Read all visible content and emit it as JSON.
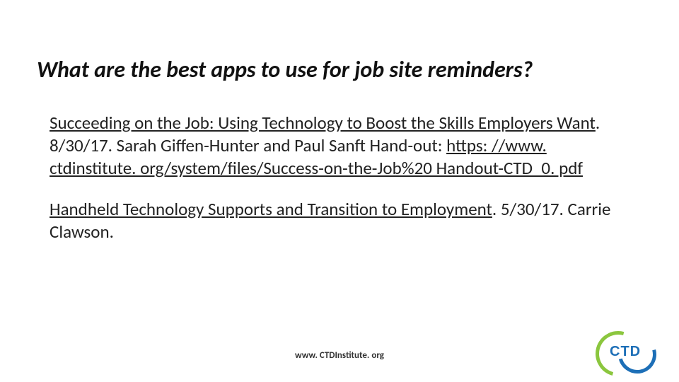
{
  "title": "What are the best apps to use for job site reminders?",
  "p1": {
    "link1": "Succeeding on the Job: Using Technology to Boost the Skills Employers Want",
    "after1": ".  8/30/17. Sarah Giffen-Hunter and Paul Sanft  Hand-out:  ",
    "link2": "https: //www. ctdinstitute. org/system/files/Success-on-the-Job%20 Handout-CTD_0. pdf"
  },
  "p2": {
    "link1": "Handheld Technology Supports and Transition to Employment",
    "after1": ". 5/30/17.  Carrie Clawson."
  },
  "footer_url": "www. CTDInstitute. org",
  "logo_text": "CTD"
}
